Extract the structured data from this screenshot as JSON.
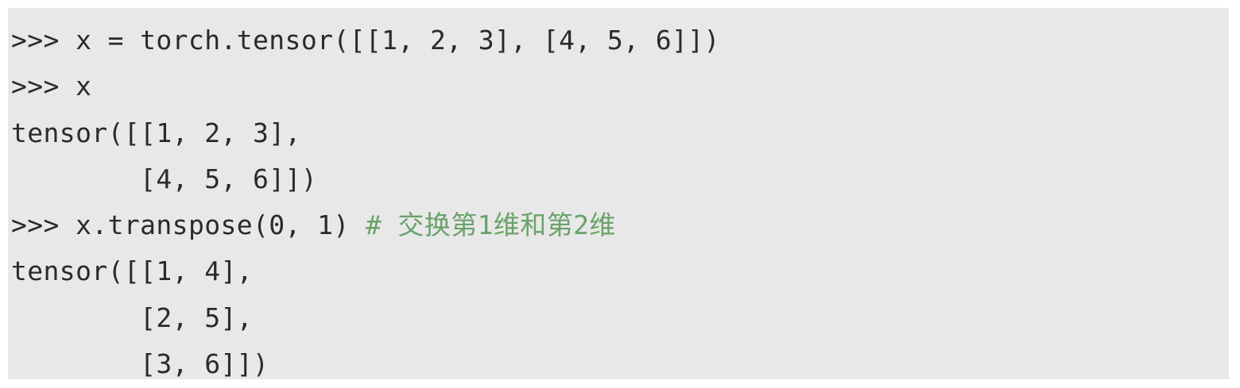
{
  "code_block": {
    "lines": [
      {
        "text": ">>> x = torch.tensor([[1, 2, 3], [4, 5, 6]])",
        "comment": ""
      },
      {
        "text": ">>> x",
        "comment": ""
      },
      {
        "text": "tensor([[1, 2, 3],",
        "comment": ""
      },
      {
        "text": "        [4, 5, 6]])",
        "comment": ""
      },
      {
        "text": ">>> x.transpose(0, 1) ",
        "comment": "# 交换第1维和第2维"
      },
      {
        "text": "tensor([[1, 4],",
        "comment": ""
      },
      {
        "text": "        [2, 5],",
        "comment": ""
      },
      {
        "text": "        [3, 6]])",
        "comment": ""
      }
    ]
  },
  "colors": {
    "background": "#e8e8e8",
    "text": "#2a2a2a",
    "comment": "#6aa26a"
  }
}
